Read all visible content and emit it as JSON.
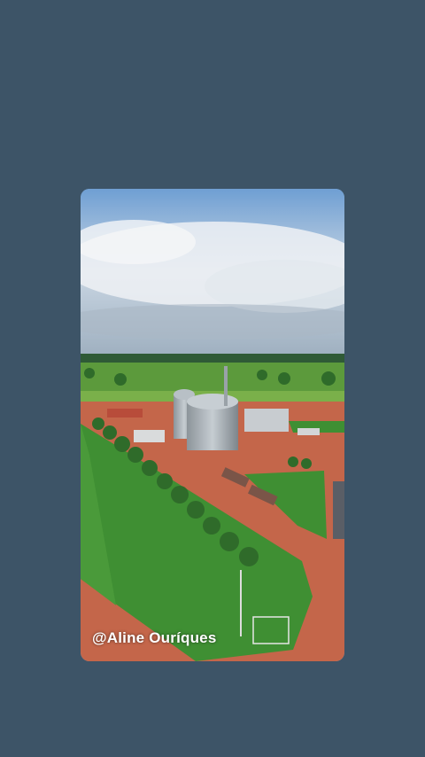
{
  "photo": {
    "subject": "aerial-farm-grain-silos",
    "watermark": "@Aline Ouríques"
  },
  "colors": {
    "background": "#3d5467",
    "sky": "#8fb4dc",
    "grass": "#3f8f33",
    "dirt": "#c4664a"
  }
}
